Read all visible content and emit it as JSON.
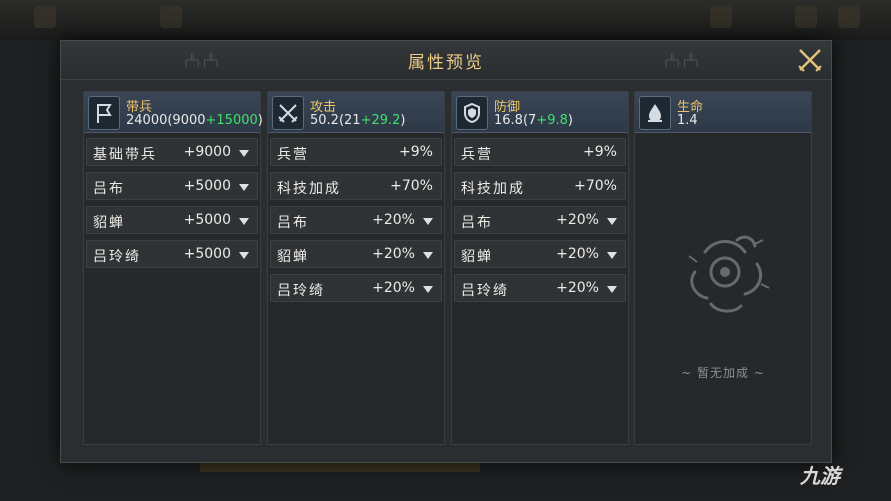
{
  "panel": {
    "title": "属性预览",
    "decor_left": "┌╨┐┌╨┐",
    "decor_right": "┌╨┐┌╨┐"
  },
  "columns": [
    {
      "name": "带兵",
      "value_base": "24000(9000",
      "value_bonus": "+15000",
      "value_close": ")",
      "icon": "banner-icon",
      "rows": [
        {
          "label": "基础带兵",
          "value": "+9000",
          "dropdown": true
        },
        {
          "label": "吕布",
          "value": "+5000",
          "dropdown": true
        },
        {
          "label": "貂蝉",
          "value": "+5000",
          "dropdown": true
        },
        {
          "label": "吕玲绮",
          "value": "+5000",
          "dropdown": true
        }
      ]
    },
    {
      "name": "攻击",
      "value_base": "50.2(21",
      "value_bonus": "+29.2",
      "value_close": ")",
      "icon": "crossed-swords-icon",
      "rows": [
        {
          "label": "兵营",
          "value": "+9%",
          "dropdown": false
        },
        {
          "label": "科技加成",
          "value": "+70%",
          "dropdown": false
        },
        {
          "label": "吕布",
          "value": "+20%",
          "dropdown": true
        },
        {
          "label": "貂蝉",
          "value": "+20%",
          "dropdown": true
        },
        {
          "label": "吕玲绮",
          "value": "+20%",
          "dropdown": true
        }
      ]
    },
    {
      "name": "防御",
      "value_base": "16.8(7",
      "value_bonus": "+9.8",
      "value_close": ")",
      "icon": "shield-icon",
      "rows": [
        {
          "label": "兵营",
          "value": "+9%",
          "dropdown": false
        },
        {
          "label": "科技加成",
          "value": "+70%",
          "dropdown": false
        },
        {
          "label": "吕布",
          "value": "+20%",
          "dropdown": true
        },
        {
          "label": "貂蝉",
          "value": "+20%",
          "dropdown": true
        },
        {
          "label": "吕玲绮",
          "value": "+20%",
          "dropdown": true
        }
      ]
    },
    {
      "name": "生命",
      "value_base": "1.4",
      "value_bonus": "",
      "value_close": "",
      "icon": "water-drop-icon",
      "rows": [],
      "empty_text": "~ 暂无加成 ~"
    }
  ],
  "watermark": "九游",
  "colors": {
    "gold": "#ecc466",
    "green": "#3fe06a",
    "panel": "#2b2e31"
  }
}
